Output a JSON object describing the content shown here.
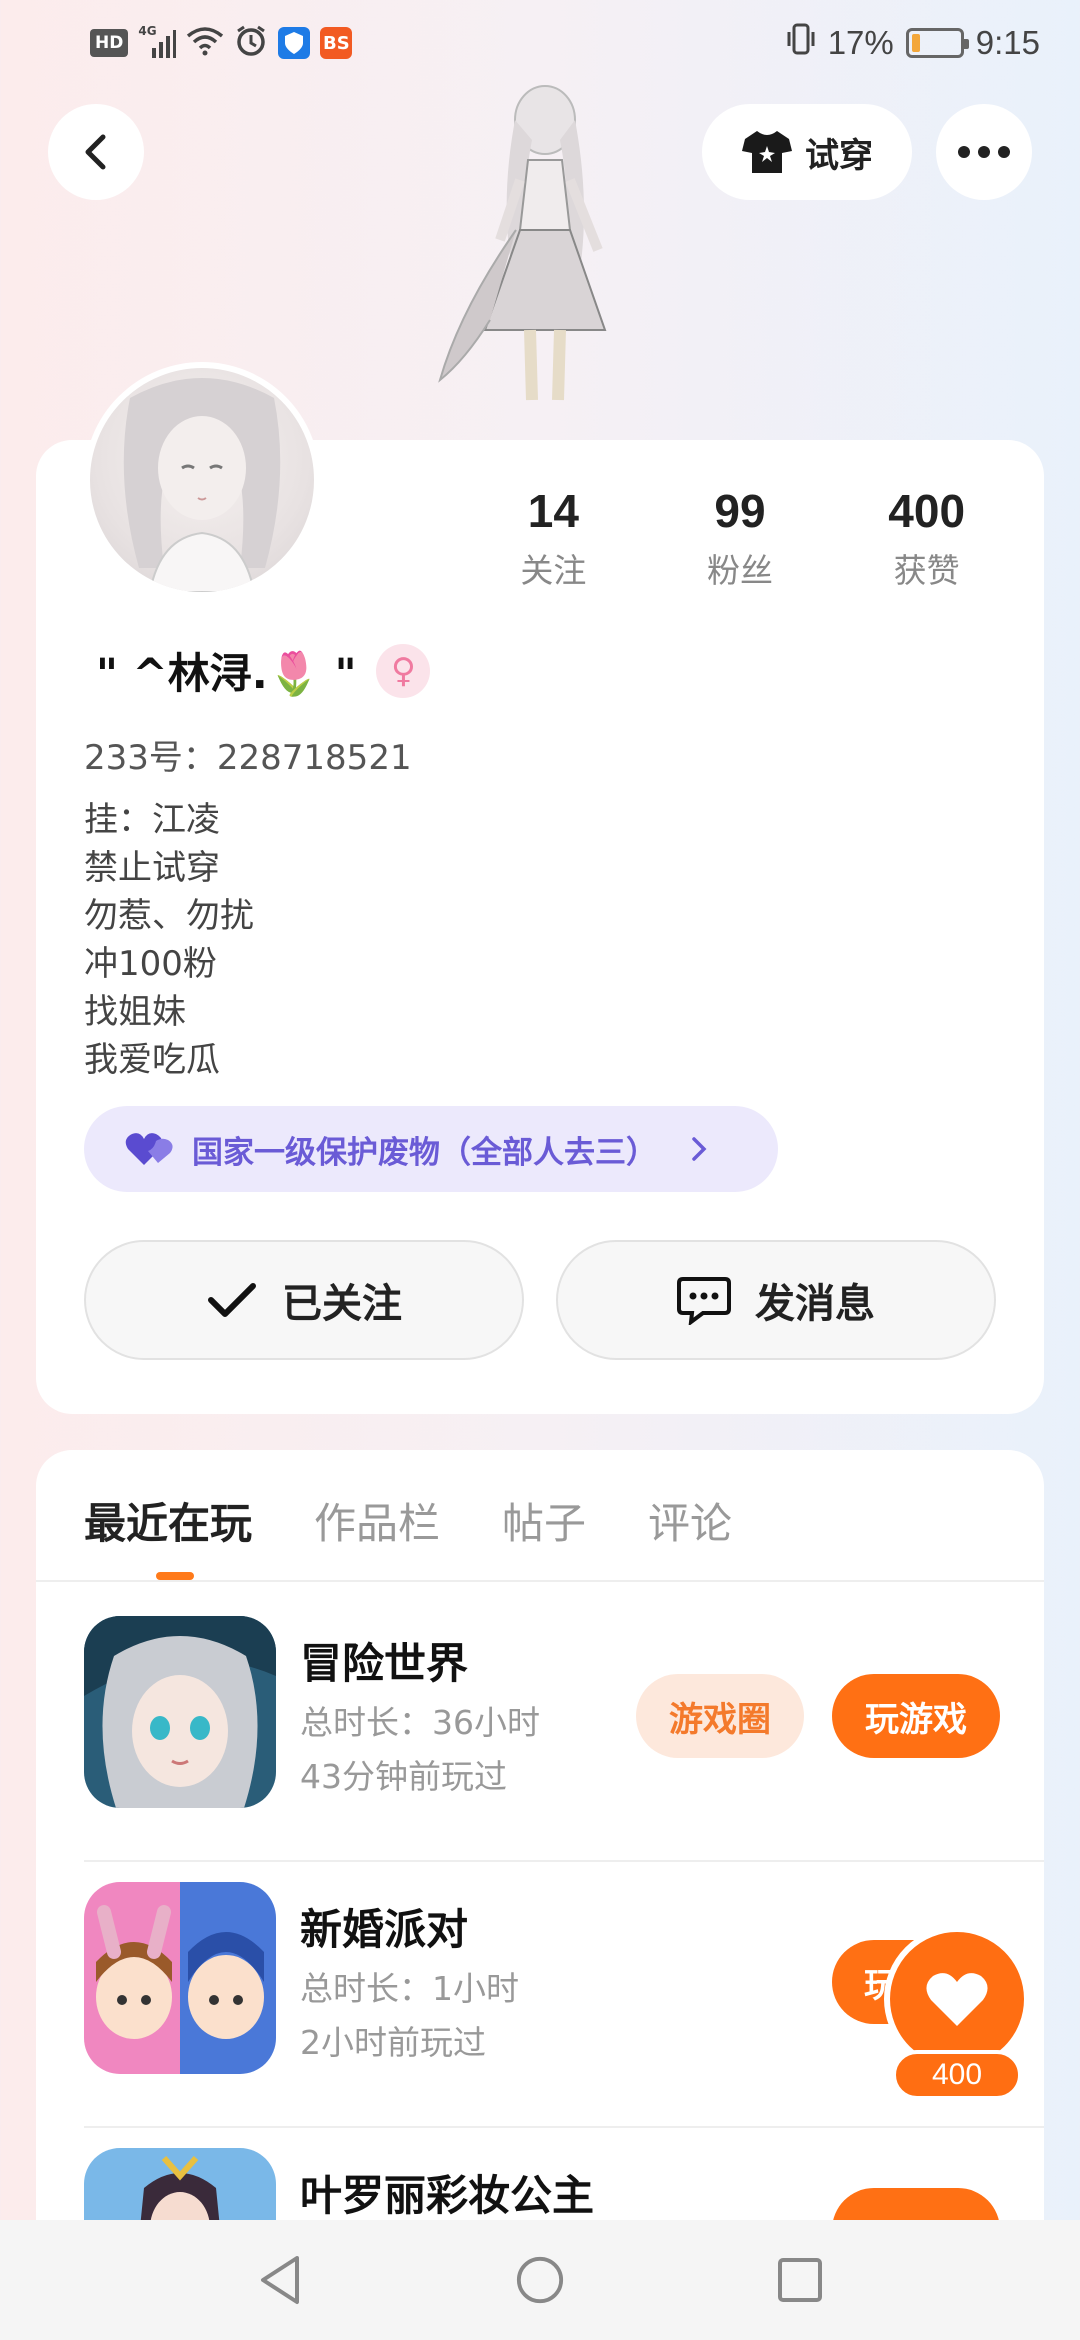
{
  "status_bar": {
    "hd": "HD",
    "net": "4G",
    "app_badge": "BS",
    "battery_percent": "17%",
    "battery_level": 0.17,
    "time": "9:15"
  },
  "header": {
    "tryon_label": "试穿"
  },
  "profile": {
    "stats": [
      {
        "num": "14",
        "label": "关注"
      },
      {
        "num": "99",
        "label": "粉丝"
      },
      {
        "num": "400",
        "label": "获赞"
      }
    ],
    "name": "\" ^林浔.🌷 \"",
    "gender_symbol": "♀",
    "uid": "233号：228718521",
    "bio": [
      "挂：江凌",
      "禁止试穿",
      "勿惹、勿扰",
      "冲100粉",
      "找姐妹",
      "我爱吃瓜"
    ],
    "badge_text": "国家一级保护废物（全部人去三）",
    "follow_label": "已关注",
    "message_label": "发消息"
  },
  "tabs": [
    "最近在玩",
    "作品栏",
    "帖子",
    "评论"
  ],
  "games": [
    {
      "title": "冒险世界",
      "duration": "总时长：36小时",
      "last": "43分钟前玩过",
      "circle_label": "游戏圈",
      "play_label": "玩游戏"
    },
    {
      "title": "新婚派对",
      "duration": "总时长：1小时",
      "last": "2小时前玩过",
      "play_label": "玩"
    },
    {
      "title": "叶罗丽彩妆公主"
    }
  ],
  "float_like": {
    "count": "400"
  },
  "colors": {
    "accent": "#ff7014",
    "badge_bg": "#ece9fc",
    "badge_text": "#6a5bd6"
  }
}
